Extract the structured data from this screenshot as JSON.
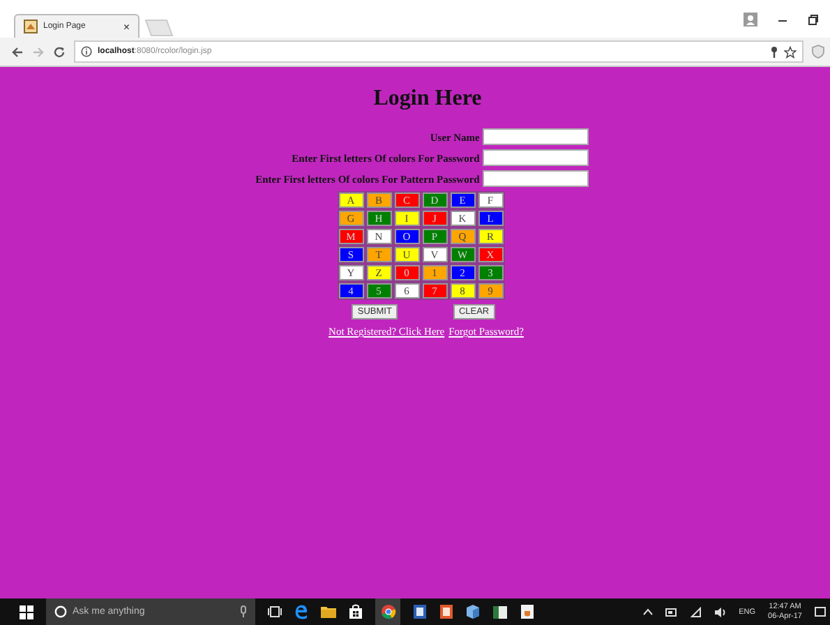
{
  "browser": {
    "tab_title": "Login Page",
    "tab_close": "×",
    "url_host": "localhost",
    "url_path": ":8080/rcolor/login.jsp"
  },
  "page": {
    "title": "Login Here",
    "fields": [
      {
        "label": "User Name"
      },
      {
        "label": "Enter First letters Of colors For Password"
      },
      {
        "label": "Enter First letters Of colors For Pattern Password"
      }
    ],
    "grid": [
      [
        {
          "text": "A",
          "color": "#ffff00"
        },
        {
          "text": "B",
          "color": "#ffa500"
        },
        {
          "text": "C",
          "color": "#ff0000"
        },
        {
          "text": "D",
          "color": "#008000"
        },
        {
          "text": "E",
          "color": "#0000ff"
        },
        {
          "text": "F",
          "color": "#ffffff"
        }
      ],
      [
        {
          "text": "G",
          "color": "#ffa500"
        },
        {
          "text": "H",
          "color": "#008000"
        },
        {
          "text": "I",
          "color": "#ffff00"
        },
        {
          "text": "J",
          "color": "#ff0000"
        },
        {
          "text": "K",
          "color": "#ffffff"
        },
        {
          "text": "L",
          "color": "#0000ff"
        }
      ],
      [
        {
          "text": "M",
          "color": "#ff0000"
        },
        {
          "text": "N",
          "color": "#ffffff"
        },
        {
          "text": "O",
          "color": "#0000ff"
        },
        {
          "text": "P",
          "color": "#008000"
        },
        {
          "text": "Q",
          "color": "#ffa500"
        },
        {
          "text": "R",
          "color": "#ffff00"
        }
      ],
      [
        {
          "text": "S",
          "color": "#0000ff"
        },
        {
          "text": "T",
          "color": "#ffa500"
        },
        {
          "text": "U",
          "color": "#ffff00"
        },
        {
          "text": "V",
          "color": "#ffffff"
        },
        {
          "text": "W",
          "color": "#008000"
        },
        {
          "text": "X",
          "color": "#ff0000"
        }
      ],
      [
        {
          "text": "Y",
          "color": "#ffffff"
        },
        {
          "text": "Z",
          "color": "#ffff00"
        },
        {
          "text": "0",
          "color": "#ff0000"
        },
        {
          "text": "1",
          "color": "#ffa500"
        },
        {
          "text": "2",
          "color": "#0000ff"
        },
        {
          "text": "3",
          "color": "#008000"
        }
      ],
      [
        {
          "text": "4",
          "color": "#0000ff"
        },
        {
          "text": "5",
          "color": "#008000"
        },
        {
          "text": "6",
          "color": "#ffffff"
        },
        {
          "text": "7",
          "color": "#ff0000"
        },
        {
          "text": "8",
          "color": "#ffff00"
        },
        {
          "text": "9",
          "color": "#ffa500"
        }
      ]
    ],
    "buttons": [
      "SUBMIT",
      "CLEAR"
    ],
    "links": [
      "Not Registered? Click Here",
      "Forgot Password?"
    ]
  },
  "taskbar": {
    "search_placeholder": "Ask me anything",
    "language": "ENG",
    "time": "12:47 AM",
    "date": "06-Apr-17"
  }
}
